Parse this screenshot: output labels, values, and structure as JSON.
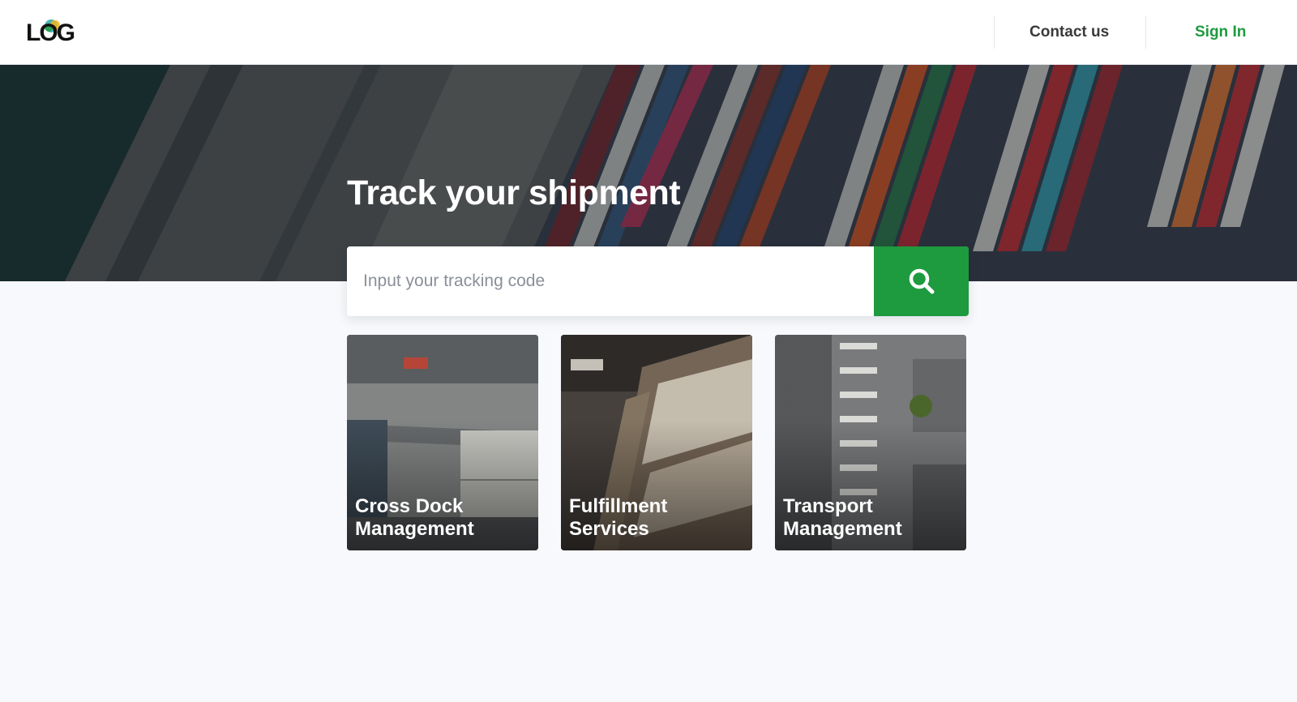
{
  "brand": {
    "logo_text": "LOG",
    "accent_color": "#1e9a3f"
  },
  "nav": {
    "contact_label": "Contact us",
    "signin_label": "Sign In"
  },
  "hero": {
    "title": "Track your shipment",
    "background": "aerial-container-port-image"
  },
  "search": {
    "placeholder": "Input your tracking code",
    "value": "",
    "button_icon": "search-icon"
  },
  "services": [
    {
      "title": "Cross Dock\nManagement",
      "image": "container-yard-image"
    },
    {
      "title": "Fulfillment\nServices",
      "image": "warehouse-shelves-image"
    },
    {
      "title": "Transport\nManagement",
      "image": "aerial-loading-dock-image"
    }
  ]
}
